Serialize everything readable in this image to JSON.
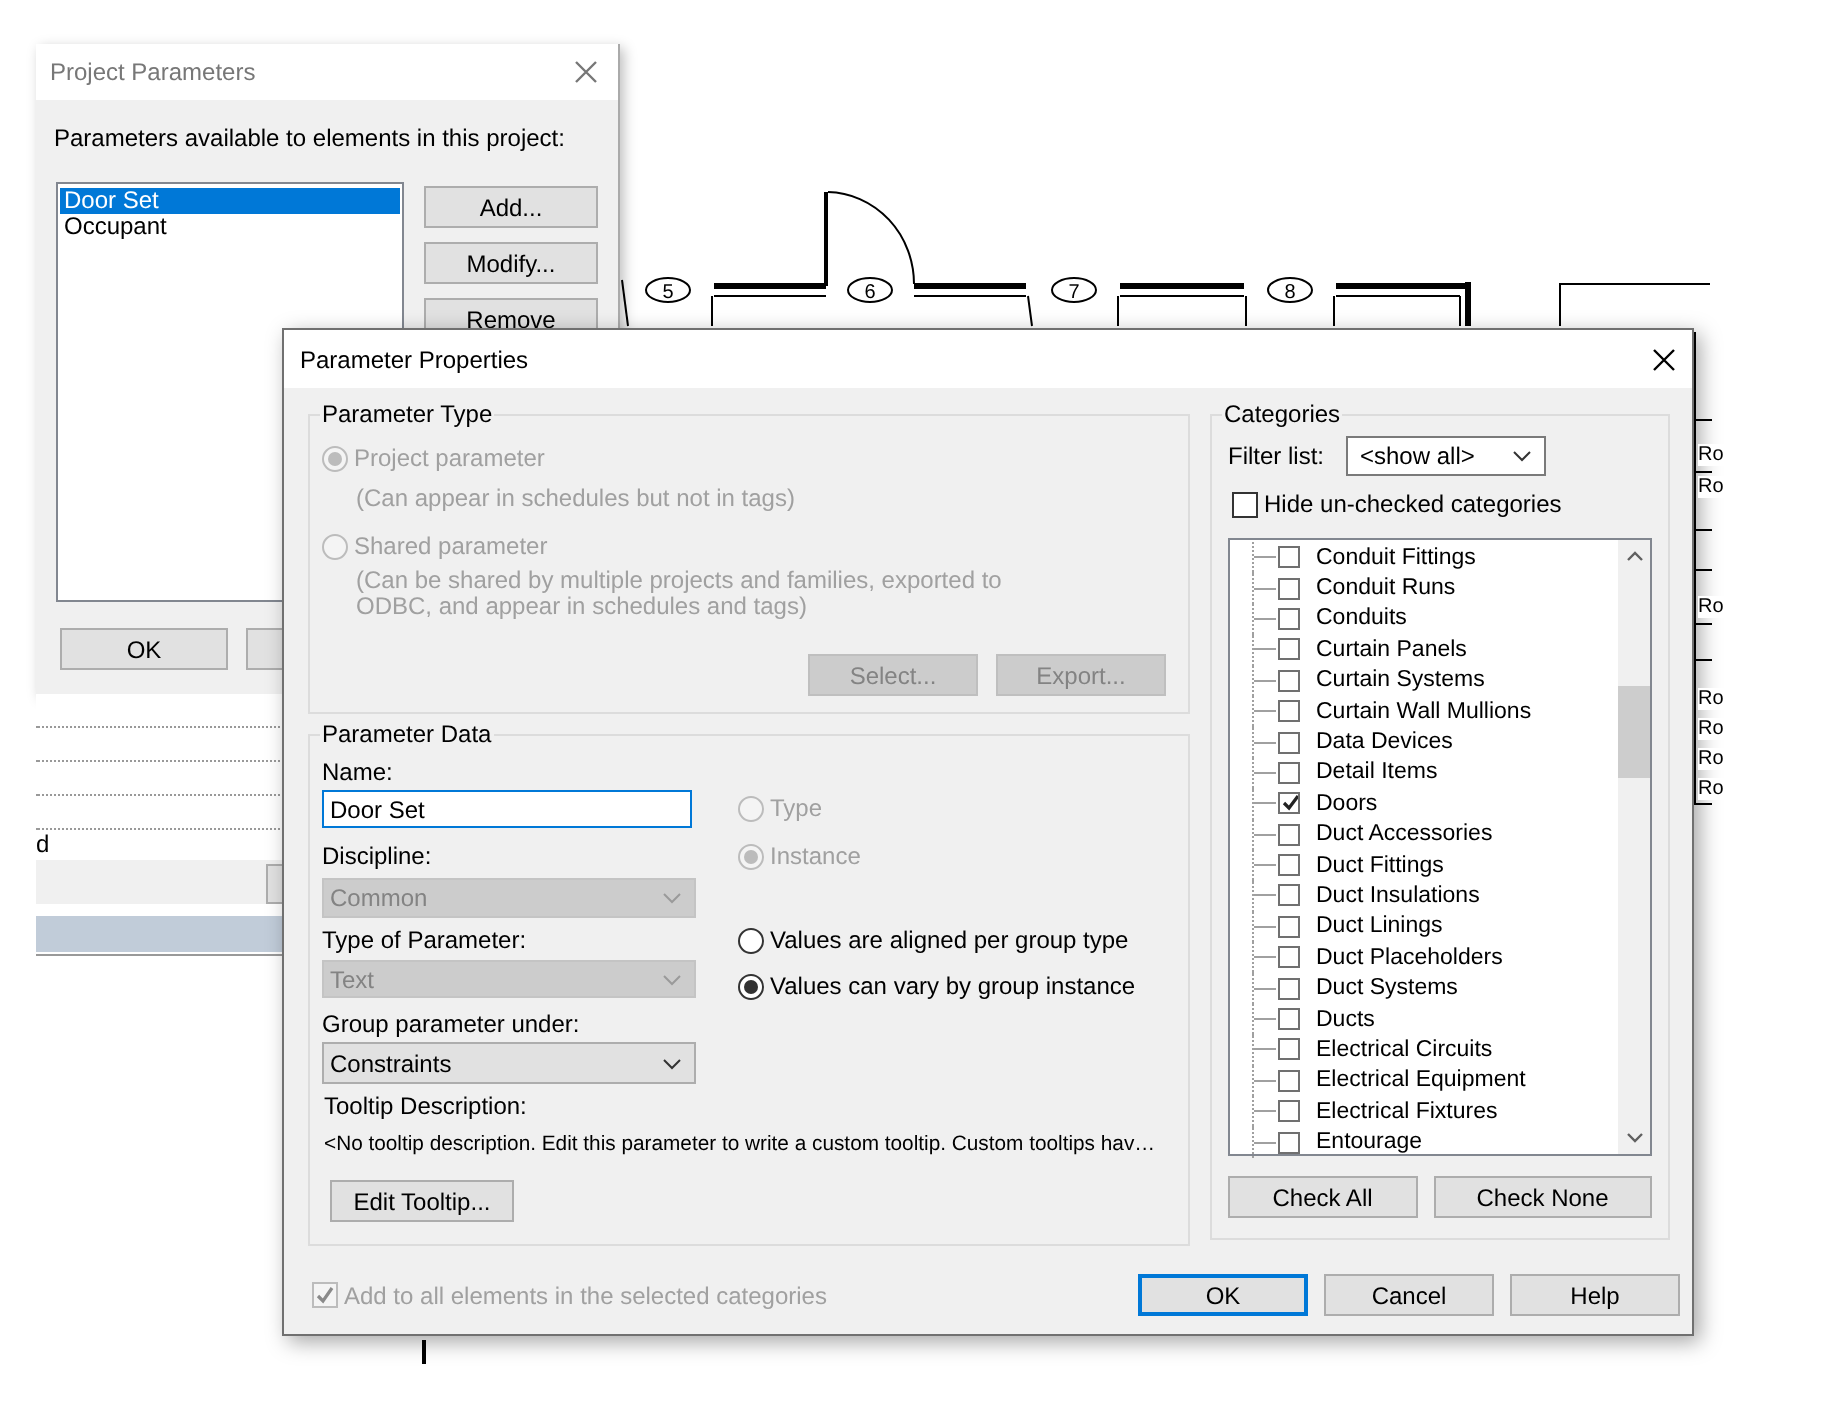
{
  "cad_view": {
    "tags": [
      "5",
      "6",
      "7",
      "8"
    ],
    "room_labels": [
      "Ro",
      "Ro",
      "Ro",
      "Ro",
      "Ro",
      "Ro",
      "Ro"
    ]
  },
  "project_parameters": {
    "title": "Project Parameters",
    "label": "Parameters available to elements in this project:",
    "list": [
      {
        "label": "Door Set",
        "selected": true
      },
      {
        "label": "Occupant",
        "selected": false
      }
    ],
    "side_buttons": [
      "Add...",
      "Modify...",
      "Remove"
    ],
    "bottom_buttons": [
      "OK"
    ]
  },
  "background_panel": {
    "fragment": "d"
  },
  "parameter_properties": {
    "title": "Parameter Properties",
    "parameter_type": {
      "legend": "Parameter Type",
      "options": [
        {
          "label": "Project parameter",
          "note": "(Can appear in schedules but not in tags)",
          "selected": true,
          "disabled": true
        },
        {
          "label": "Shared parameter",
          "note": "(Can be shared by multiple projects and families, exported to ODBC, and appear in schedules and tags)",
          "selected": false,
          "disabled": true
        }
      ],
      "buttons": [
        {
          "label": "Select...",
          "disabled": true
        },
        {
          "label": "Export...",
          "disabled": true
        }
      ]
    },
    "parameter_data": {
      "legend": "Parameter Data",
      "name_label": "Name:",
      "name_value": "Door Set",
      "fields": [
        {
          "label": "Discipline:",
          "value": "Common",
          "disabled": true
        },
        {
          "label": "Type of Parameter:",
          "value": "Text",
          "disabled": true
        },
        {
          "label": "Group parameter under:",
          "value": "Constraints",
          "disabled": false
        }
      ],
      "type_instance": [
        {
          "label": "Type",
          "selected": false,
          "disabled": true
        },
        {
          "label": "Instance",
          "selected": true,
          "disabled": true
        }
      ],
      "group_values": [
        {
          "label": "Values are aligned per group type",
          "selected": false,
          "disabled": false
        },
        {
          "label": "Values can vary by group instance",
          "selected": true,
          "disabled": false
        }
      ],
      "tooltip_label": "Tooltip Description:",
      "tooltip_text": "<No tooltip description. Edit this parameter to write a custom tooltip. Custom tooltips hav…",
      "edit_tooltip_button": "Edit Tooltip..."
    },
    "categories": {
      "legend": "Categories",
      "filter_label": "Filter list:",
      "filter_value": "<show all>",
      "hide_unchecked": {
        "label": "Hide un-checked categories",
        "checked": false
      },
      "items": [
        {
          "label": "Conduit Fittings",
          "checked": false
        },
        {
          "label": "Conduit Runs",
          "checked": false
        },
        {
          "label": "Conduits",
          "checked": false
        },
        {
          "label": "Curtain Panels",
          "checked": false
        },
        {
          "label": "Curtain Systems",
          "checked": false
        },
        {
          "label": "Curtain Wall Mullions",
          "checked": false
        },
        {
          "label": "Data Devices",
          "checked": false
        },
        {
          "label": "Detail Items",
          "checked": false
        },
        {
          "label": "Doors",
          "checked": true
        },
        {
          "label": "Duct Accessories",
          "checked": false
        },
        {
          "label": "Duct Fittings",
          "checked": false
        },
        {
          "label": "Duct Insulations",
          "checked": false
        },
        {
          "label": "Duct Linings",
          "checked": false
        },
        {
          "label": "Duct Placeholders",
          "checked": false
        },
        {
          "label": "Duct Systems",
          "checked": false
        },
        {
          "label": "Ducts",
          "checked": false
        },
        {
          "label": "Electrical Circuits",
          "checked": false
        },
        {
          "label": "Electrical Equipment",
          "checked": false
        },
        {
          "label": "Electrical Fixtures",
          "checked": false
        },
        {
          "label": "Entourage",
          "checked": false
        }
      ],
      "buttons": [
        "Check All",
        "Check None"
      ]
    },
    "add_to_all": {
      "label": "Add to all elements in the selected categories",
      "checked": true,
      "disabled": true
    },
    "buttons": [
      {
        "label": "OK",
        "default": true
      },
      {
        "label": "Cancel",
        "default": false
      },
      {
        "label": "Help",
        "default": false
      }
    ]
  }
}
